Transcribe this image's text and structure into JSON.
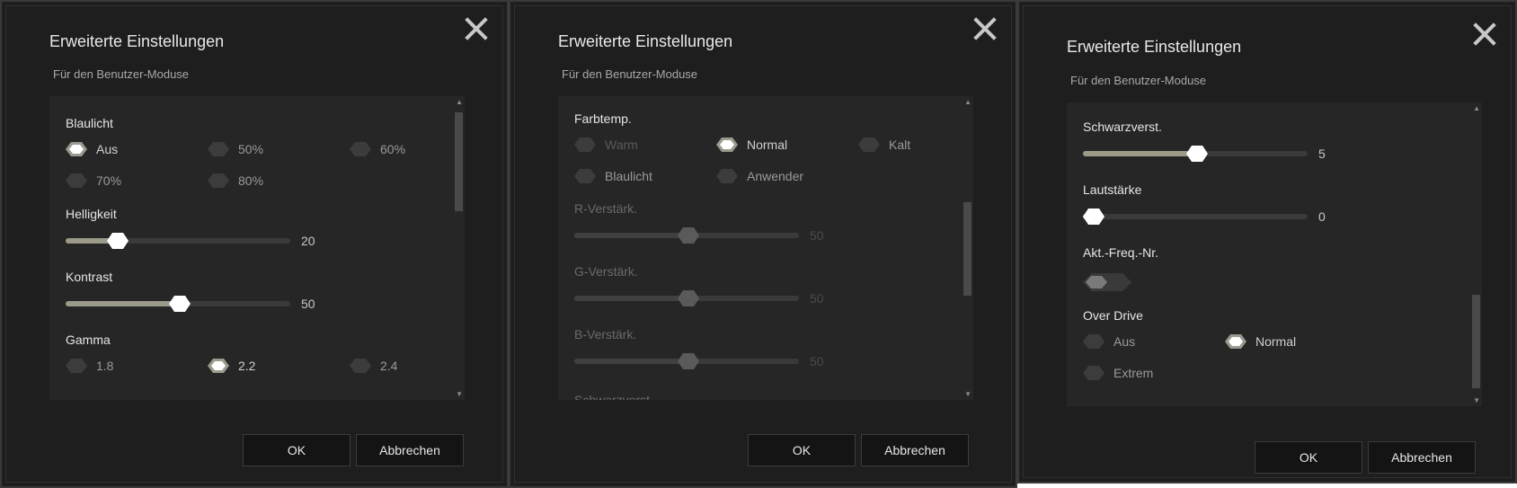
{
  "dialogs": [
    {
      "title": "Erweiterte Einstellungen",
      "subtitle": "Für den Benutzer-Moduse",
      "sections": {
        "blaulicht": {
          "label": "Blaulicht",
          "options": [
            "Aus",
            "50%",
            "60%",
            "70%",
            "80%"
          ],
          "selected": "Aus"
        },
        "helligkeit": {
          "label": "Helligkeit",
          "value": "20",
          "level": 20
        },
        "kontrast": {
          "label": "Kontrast",
          "value": "50",
          "level": 50
        },
        "gamma": {
          "label": "Gamma",
          "options": [
            "1.8",
            "2.2",
            "2.4"
          ],
          "selected": "2.2"
        }
      },
      "buttons": {
        "ok": "OK",
        "cancel": "Abbrechen"
      }
    },
    {
      "title": "Erweiterte Einstellungen",
      "subtitle": "Für den Benutzer-Moduse",
      "sections": {
        "farbtemp": {
          "label": "Farbtemp.",
          "options": [
            "Warm",
            "Normal",
            "Kalt",
            "Blaulicht",
            "Anwender"
          ],
          "selected": "Normal"
        },
        "r_gain": {
          "label": "R-Verstärk.",
          "value": "50",
          "level": 50
        },
        "g_gain": {
          "label": "G-Verstärk.",
          "value": "50",
          "level": 50
        },
        "b_gain": {
          "label": "B-Verstärk.",
          "value": "50",
          "level": 50
        },
        "partial": {
          "label": "Schwarzverst."
        }
      },
      "buttons": {
        "ok": "OK",
        "cancel": "Abbrechen"
      }
    },
    {
      "title": "Erweiterte Einstellungen",
      "subtitle": "Für den Benutzer-Moduse",
      "sections": {
        "schwarz": {
          "label": "Schwarzverst.",
          "value": "5",
          "level": 50
        },
        "lautstaerke": {
          "label": "Lautstärke",
          "value": "0",
          "level": 0
        },
        "freq": {
          "label": "Akt.-Freq.-Nr.",
          "state": "off"
        },
        "overdrive": {
          "label": "Over Drive",
          "options": [
            "Aus",
            "Normal",
            "Extrem"
          ],
          "selected": "Normal"
        }
      },
      "buttons": {
        "ok": "OK",
        "cancel": "Abbrechen"
      }
    }
  ],
  "colors": {
    "background": "#1e1e1e",
    "panel": "#262626",
    "accent_fill": "#9c9a88",
    "thumb": "#ffffff",
    "button": "#141414"
  }
}
